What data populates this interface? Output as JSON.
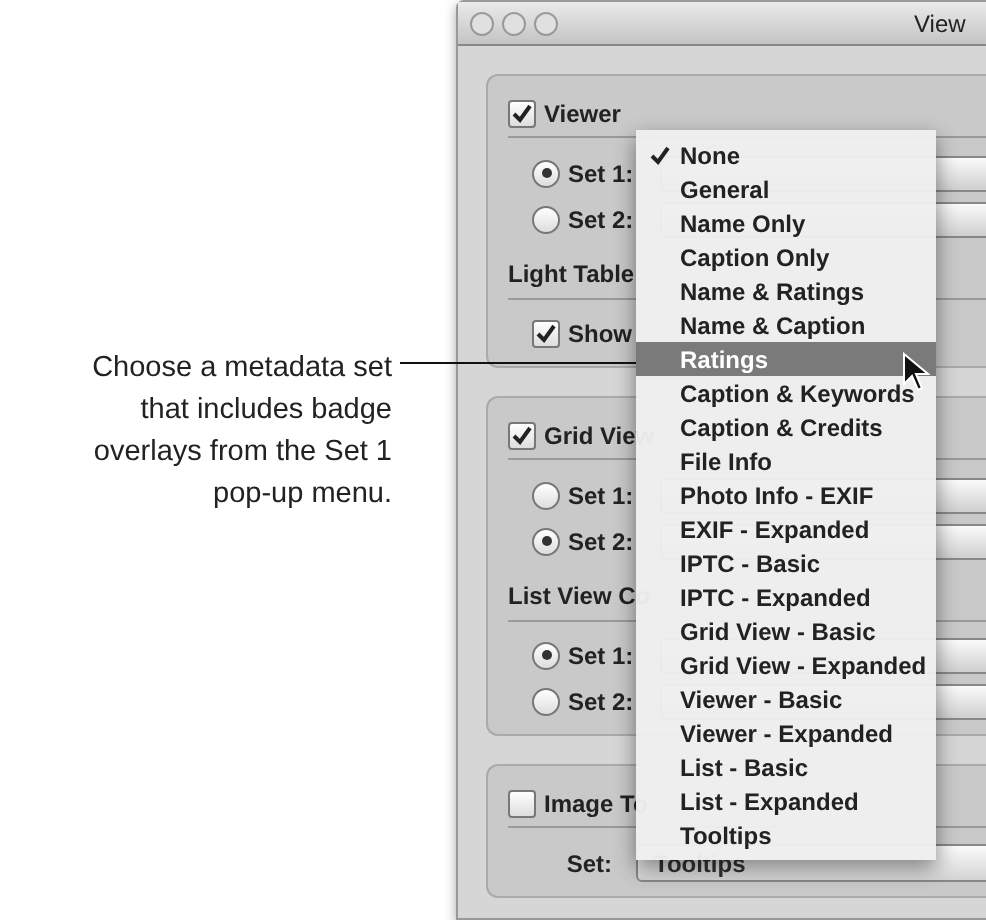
{
  "callout": {
    "lines": [
      "Choose a metadata set",
      "that includes badge",
      "overlays from the Set 1",
      "pop-up menu."
    ]
  },
  "window": {
    "title": "View"
  },
  "sections": [
    {
      "checkbox": {
        "label": "Viewer",
        "checked": true
      },
      "rows": [
        {
          "kind": "radio",
          "label": "Set 1:",
          "selected": true
        },
        {
          "kind": "radio",
          "label": "Set 2:",
          "selected": false
        },
        {
          "kind": "heading",
          "label": "Light Table"
        },
        {
          "kind": "checkbox",
          "label": "Show",
          "checked": true
        }
      ]
    },
    {
      "checkbox": {
        "label": "Grid View",
        "checked": true
      },
      "rows": [
        {
          "kind": "radio",
          "label": "Set 1:",
          "selected": false
        },
        {
          "kind": "radio",
          "label": "Set 2:",
          "selected": true
        },
        {
          "kind": "heading",
          "label": "List View Co"
        },
        {
          "kind": "radio",
          "label": "Set 1:",
          "selected": true
        },
        {
          "kind": "radio",
          "label": "Set 2:",
          "selected": false
        }
      ]
    },
    {
      "checkbox": {
        "label": "Image To",
        "checked": false
      },
      "rows": [
        {
          "kind": "popup",
          "label": "Set:",
          "value": "Tooltips"
        }
      ]
    }
  ],
  "menu": {
    "items": [
      {
        "label": "None",
        "checked": true,
        "selected": false
      },
      {
        "label": "General",
        "checked": false,
        "selected": false
      },
      {
        "label": "Name Only",
        "checked": false,
        "selected": false
      },
      {
        "label": "Caption Only",
        "checked": false,
        "selected": false
      },
      {
        "label": "Name & Ratings",
        "checked": false,
        "selected": false
      },
      {
        "label": "Name & Caption",
        "checked": false,
        "selected": false
      },
      {
        "label": "Ratings",
        "checked": false,
        "selected": true
      },
      {
        "label": "Caption & Keywords",
        "checked": false,
        "selected": false
      },
      {
        "label": "Caption & Credits",
        "checked": false,
        "selected": false
      },
      {
        "label": "File Info",
        "checked": false,
        "selected": false
      },
      {
        "label": "Photo Info - EXIF",
        "checked": false,
        "selected": false
      },
      {
        "label": "EXIF - Expanded",
        "checked": false,
        "selected": false
      },
      {
        "label": "IPTC - Basic",
        "checked": false,
        "selected": false
      },
      {
        "label": "IPTC - Expanded",
        "checked": false,
        "selected": false
      },
      {
        "label": "Grid View - Basic",
        "checked": false,
        "selected": false
      },
      {
        "label": "Grid View - Expanded",
        "checked": false,
        "selected": false
      },
      {
        "label": "Viewer - Basic",
        "checked": false,
        "selected": false
      },
      {
        "label": "Viewer - Expanded",
        "checked": false,
        "selected": false
      },
      {
        "label": "List - Basic",
        "checked": false,
        "selected": false
      },
      {
        "label": "List - Expanded",
        "checked": false,
        "selected": false
      },
      {
        "label": "Tooltips",
        "checked": false,
        "selected": false
      }
    ]
  }
}
